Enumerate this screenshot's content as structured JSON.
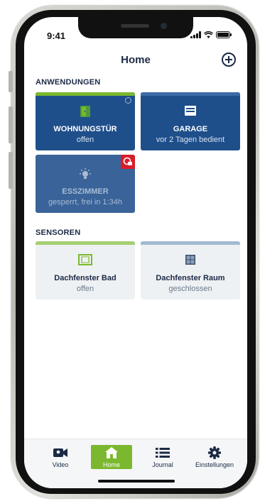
{
  "status_bar": {
    "time": "9:41"
  },
  "nav": {
    "title": "Home",
    "add_icon": "plus-circle-icon"
  },
  "sections": {
    "applications_title": "ANWENDUNGEN",
    "sensors_title": "SENSOREN"
  },
  "applications": [
    {
      "title": "WOHNUNGSTÜR",
      "status": "offen",
      "icon": "door-open-icon",
      "bar_color": "#7cb82f"
    },
    {
      "title": "GARAGE",
      "status": "vor 2 Tagen bedient",
      "icon": "garage-icon",
      "bar_color": "#3b6aa5"
    },
    {
      "title": "ESSZIMMER",
      "status": "gesperrt, frei in 1:34h",
      "icon": "lightbulb-icon",
      "badge_color": "#d91c2a"
    }
  ],
  "sensors": [
    {
      "title": "Dachfenster Bad",
      "status": "offen",
      "icon": "window-open-icon",
      "bar_color": "#a6cf72"
    },
    {
      "title": "Dachfenster Raum",
      "status": "geschlossen",
      "icon": "window-closed-icon",
      "bar_color": "#a3b9d4"
    }
  ],
  "tabbar": {
    "items": [
      {
        "label": "Video",
        "icon": "video-camera-icon",
        "active": false
      },
      {
        "label": "Home",
        "icon": "home-icon",
        "active": true
      },
      {
        "label": "Journal",
        "icon": "list-icon",
        "active": false
      },
      {
        "label": "Einstellungen",
        "icon": "gear-icon",
        "active": false
      }
    ]
  },
  "colors": {
    "accent_green": "#7cb82f",
    "tile_blue": "#1f4f8b",
    "text_navy": "#1b2a45",
    "alert_red": "#d91c2a"
  }
}
